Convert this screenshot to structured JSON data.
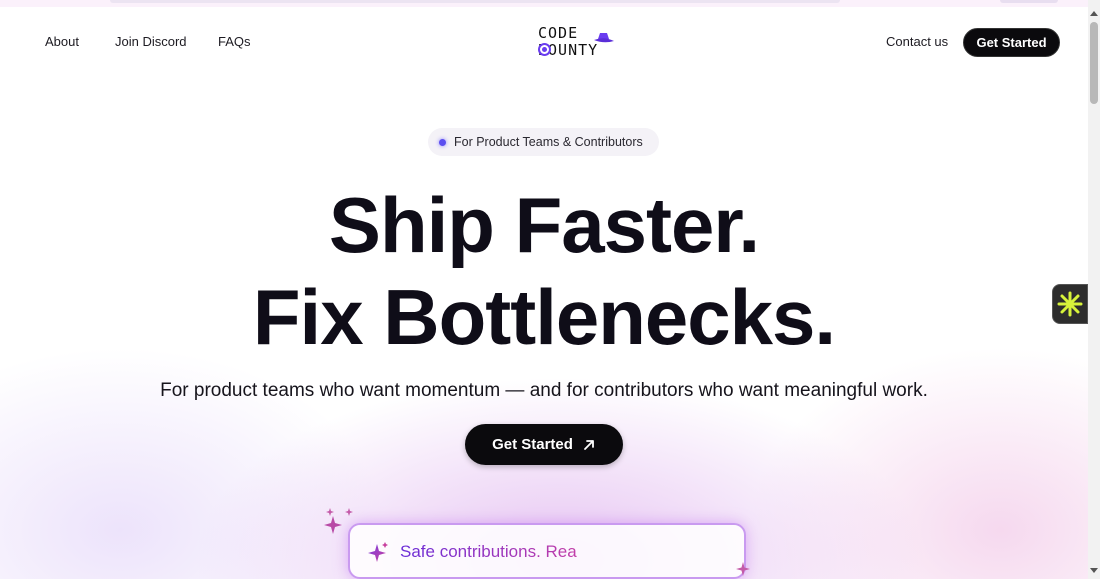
{
  "nav": {
    "links": [
      "About",
      "Join Discord",
      "FAQs"
    ],
    "contact": "Contact us",
    "cta": "Get Started"
  },
  "logo": {
    "line1": "CODE",
    "line2": "BOUNTY",
    "icons": [
      "target-icon",
      "hat-icon"
    ]
  },
  "hero": {
    "badge": "For Product Teams & Contributors",
    "title_line1": "Ship Faster.",
    "title_line2": "Fix Bottlenecks.",
    "subtitle": "For product teams who want momentum — and for contributors who want meaningful work.",
    "cta": "Get Started"
  },
  "card": {
    "text": "Safe contributions. Rea"
  },
  "colors": {
    "accent": "#6a3cf0",
    "button": "#0b0a0d",
    "widget_star": "#d7f33a"
  }
}
